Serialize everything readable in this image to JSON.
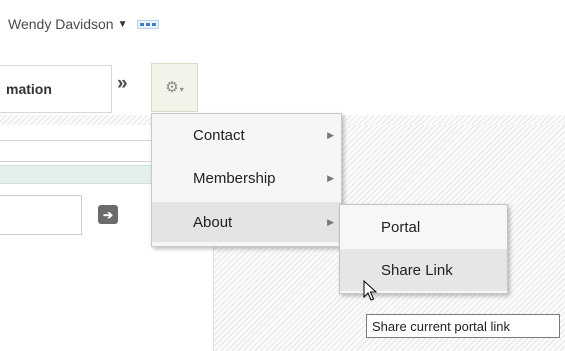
{
  "header": {
    "user_name": "Wendy Davidson",
    "caret": "▼",
    "more_icon": "ellipsis-icon"
  },
  "toolbar": {
    "tab_label": "mation",
    "more_tabs_glyph": "»",
    "gear_glyph": "⚙",
    "gear_caret": "▾"
  },
  "form": {
    "go_glyph": "➔"
  },
  "menu": {
    "items": [
      {
        "label": "Contact",
        "arrow": "▶"
      },
      {
        "label": "Membership",
        "arrow": "▶"
      },
      {
        "label": "About",
        "arrow": "▶"
      }
    ]
  },
  "submenu": {
    "items": [
      {
        "label": "Portal"
      },
      {
        "label": "Share Link"
      }
    ]
  },
  "tooltip": {
    "text": "Share current portal link"
  },
  "colors": {
    "accent": "#3f7fcf",
    "gear_bg": "#f2f4e9",
    "green_strip": "#e3f0ec",
    "menu_bg": "#f6f6f6",
    "menu_active": "#e4e4e4"
  }
}
